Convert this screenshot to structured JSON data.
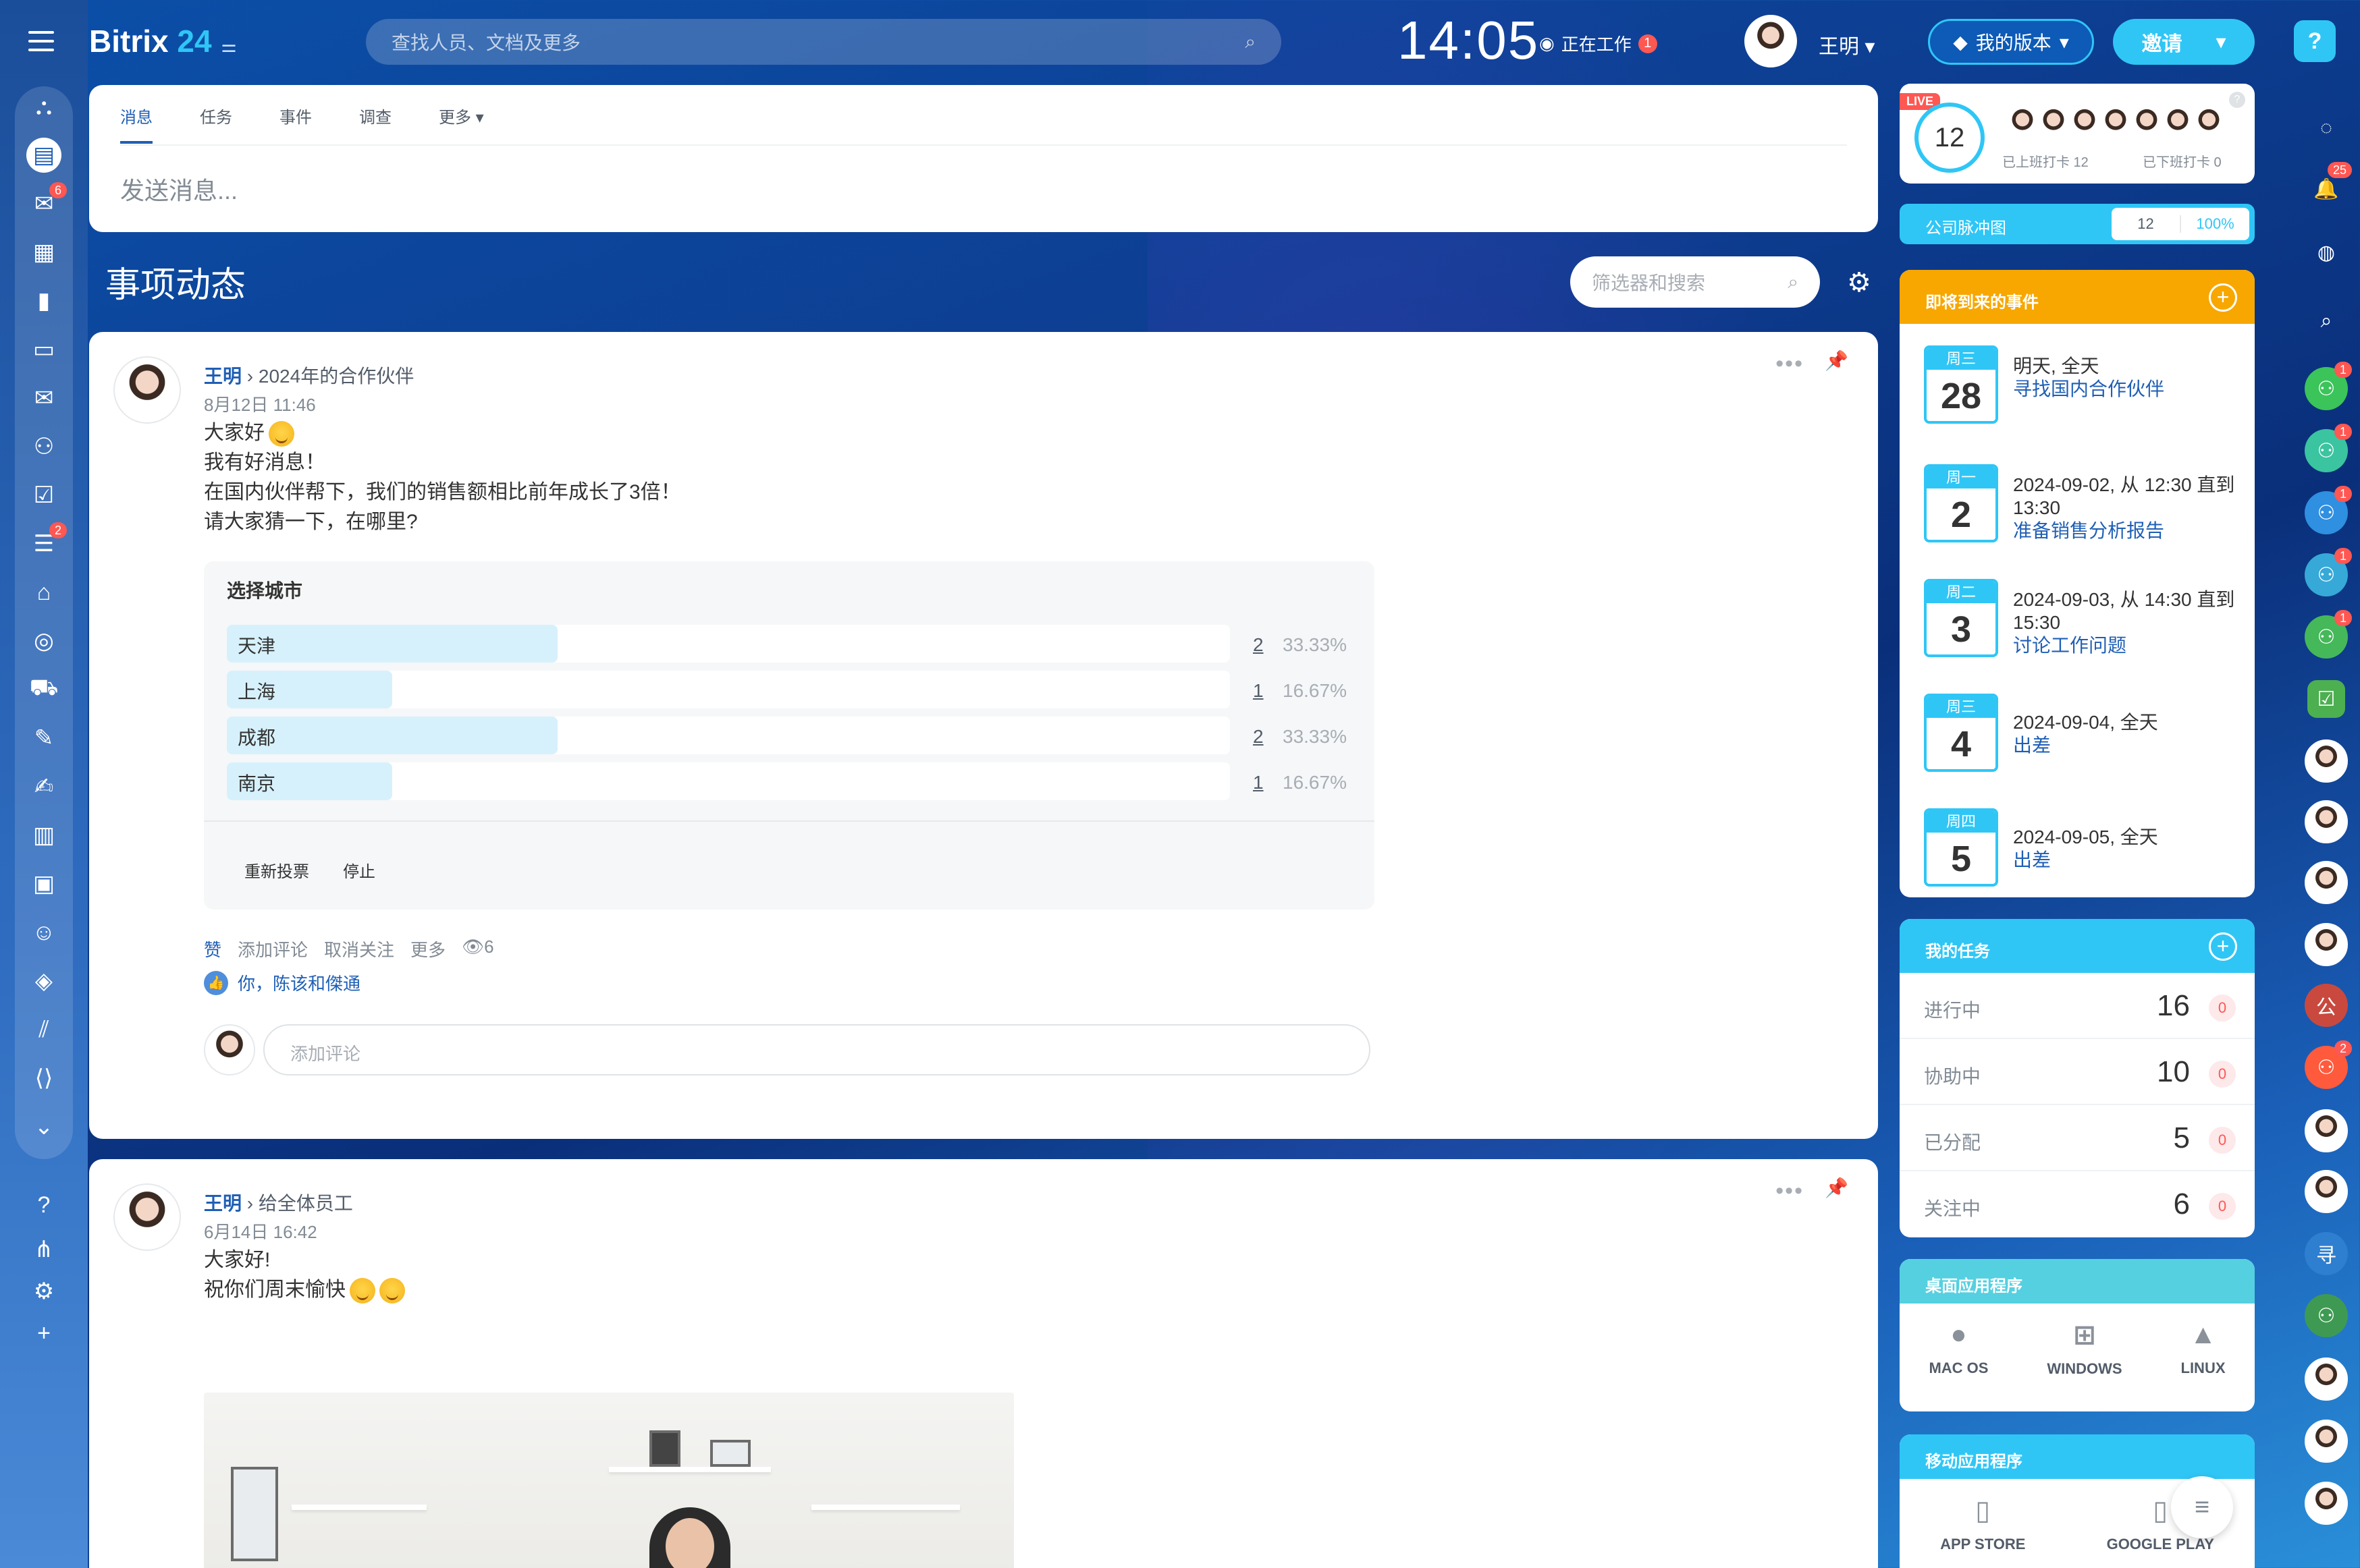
{
  "app": {
    "name": "Bitrix",
    "version": "24",
    "search_placeholder": "查找人员、文档及更多",
    "clock": "14:05",
    "work_status": "正在工作",
    "work_badge": "1",
    "user": "王明",
    "my_version": "我的版本",
    "invite": "邀请",
    "help": "?"
  },
  "leftbar": {
    "badges": {
      "chat": "6",
      "feed": "2"
    }
  },
  "composer": {
    "tabs": [
      "消息",
      "任务",
      "事件",
      "调查",
      "更多"
    ],
    "placeholder": "发送消息..."
  },
  "feed": {
    "title": "事项动态",
    "filter_placeholder": "筛选器和搜索"
  },
  "post1": {
    "author": "王明",
    "target": "2024年的合作伙伴",
    "date": "8月12日 11:46",
    "lines": [
      "大家好",
      "我有好消息！",
      "在国内伙伴帮下，我们的销售额相比前年成长了3倍！",
      "请大家猜一下，在哪里?"
    ],
    "poll": {
      "question": "选择城市",
      "options": [
        {
          "label": "天津",
          "count": "2",
          "pct": "33.33%",
          "value": 33.33
        },
        {
          "label": "上海",
          "count": "1",
          "pct": "16.67%",
          "value": 16.67
        },
        {
          "label": "成都",
          "count": "2",
          "pct": "33.33%",
          "value": 33.33
        },
        {
          "label": "南京",
          "count": "1",
          "pct": "16.67%",
          "value": 16.67
        }
      ],
      "revote": "重新投票",
      "stop": "停止"
    },
    "actions": {
      "like": "赞",
      "comment": "添加评论",
      "unfollow": "取消关注",
      "more": "更多",
      "views": "6"
    },
    "likers": "你，陈该和傑通",
    "comment_placeholder": "添加评论"
  },
  "post2": {
    "author": "王明",
    "target": "给全体员工",
    "date": "6月14日 16:42",
    "lines": [
      "大家好!",
      "祝你们周末愉快"
    ]
  },
  "widgets": {
    "live": {
      "tag": "LIVE",
      "count": "12",
      "checked_in": "已上班打卡 12",
      "checked_out": "已下班打卡 0"
    },
    "pulse": {
      "label": "公司脉冲图",
      "value": "12",
      "pct": "100%"
    },
    "events": {
      "title": "即将到来的事件",
      "items": [
        {
          "wd": "周三",
          "d": "28",
          "time": "明天, 全天",
          "title": "寻找国内合作伙伴"
        },
        {
          "wd": "周一",
          "d": "2",
          "time": "2024-09-02, 从 12:30 直到 13:30",
          "title": "准备销售分析报告"
        },
        {
          "wd": "周二",
          "d": "3",
          "time": "2024-09-03, 从 14:30 直到 15:30",
          "title": "讨论工作问题"
        },
        {
          "wd": "周三",
          "d": "4",
          "time": "2024-09-04, 全天",
          "title": "出差"
        },
        {
          "wd": "周四",
          "d": "5",
          "time": "2024-09-05, 全天",
          "title": "出差"
        }
      ]
    },
    "tasks": {
      "title": "我的任务",
      "rows": [
        {
          "label": "进行中",
          "value": "16",
          "badge": "0"
        },
        {
          "label": "协助中",
          "value": "10",
          "badge": "0"
        },
        {
          "label": "已分配",
          "value": "5",
          "badge": "0"
        },
        {
          "label": "关注中",
          "value": "6",
          "badge": "0"
        }
      ]
    },
    "desktop": {
      "title": "桌面应用程序",
      "apps": [
        "MAC OS",
        "WINDOWS",
        "LINUX"
      ]
    },
    "mobile": {
      "title": "移动应用程序",
      "apps": [
        "APP STORE",
        "GOOGLE PLAY"
      ]
    }
  },
  "rightbar": {
    "badges": {
      "notifications": "25",
      "g1": "1",
      "g2": "1",
      "g3": "1",
      "g4": "1",
      "g5": "1",
      "g6": "2"
    },
    "chat_letters": {
      "c1": "公",
      "c2": "寻"
    }
  },
  "colors": {
    "accent": "#2fc6f6",
    "brand": "#1f5fb5",
    "events_header": "#f7a700",
    "tasks_header": "#2fc6f6",
    "desktop_header": "#55d0e0"
  }
}
